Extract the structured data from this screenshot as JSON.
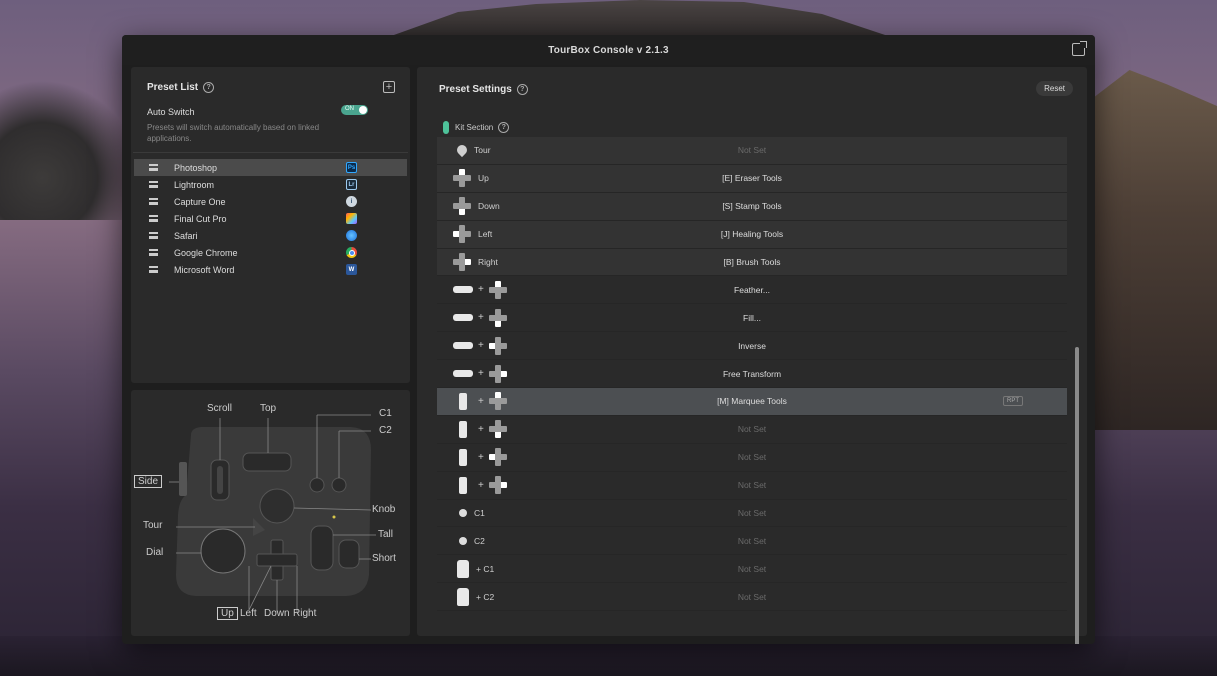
{
  "window": {
    "title": "TourBox Console v 2.1.3"
  },
  "preset_list": {
    "title": "Preset List",
    "help": "?",
    "add": "+",
    "auto_switch": {
      "label": "Auto Switch",
      "toggle": "ON",
      "description": "Presets will switch automatically based on linked applications."
    },
    "items": [
      {
        "label": "Photoshop",
        "icon": "photoshop-icon",
        "icon_text": "Ps",
        "selected": true
      },
      {
        "label": "Lightroom",
        "icon": "lightroom-icon",
        "icon_text": "Lr"
      },
      {
        "label": "Capture One",
        "icon": "capture-one-icon",
        "icon_text": "i"
      },
      {
        "label": "Final Cut Pro",
        "icon": "final-cut-pro-icon",
        "icon_text": ""
      },
      {
        "label": "Safari",
        "icon": "safari-icon",
        "icon_text": ""
      },
      {
        "label": "Google Chrome",
        "icon": "chrome-icon",
        "icon_text": ""
      },
      {
        "label": "Microsoft Word",
        "icon": "word-icon",
        "icon_text": "W"
      }
    ]
  },
  "diagram": {
    "labels": {
      "scroll": "Scroll",
      "top": "Top",
      "c1": "C1",
      "c2": "C2",
      "side": "Side",
      "knob": "Knob",
      "tour": "Tour",
      "tall": "Tall",
      "dial": "Dial",
      "short": "Short",
      "up": "Up",
      "left": "Left",
      "down": "Down",
      "right": "Right"
    }
  },
  "settings": {
    "title": "Preset Settings",
    "help": "?",
    "reset_label": "Reset",
    "kit_section": "Kit Section",
    "rows": [
      {
        "label": "Tour",
        "value": "Not Set",
        "icon": "tour-icon",
        "kit": true,
        "not_set": true
      },
      {
        "label": "Up",
        "value": "[E] Eraser Tools",
        "icon": "dpad-up-icon",
        "kit": true
      },
      {
        "label": "Down",
        "value": "[S] Stamp Tools",
        "icon": "dpad-down-icon",
        "kit": true
      },
      {
        "label": "Left",
        "value": "[J] Healing Tools",
        "icon": "dpad-left-icon",
        "kit": true
      },
      {
        "label": "Right",
        "value": "[B] Brush Tools",
        "icon": "dpad-right-icon",
        "kit": true
      },
      {
        "label": "",
        "value": "Feather...",
        "icon": "top-plus-up-icon"
      },
      {
        "label": "",
        "value": "Fill...",
        "icon": "top-plus-down-icon"
      },
      {
        "label": "",
        "value": "Inverse",
        "icon": "top-plus-left-icon"
      },
      {
        "label": "",
        "value": "Free Transform",
        "icon": "top-plus-right-icon"
      },
      {
        "label": "",
        "value": "[M] Marquee Tools",
        "icon": "side-plus-up-icon",
        "highlighted": true,
        "badge": "RPT"
      },
      {
        "label": "",
        "value": "Not Set",
        "icon": "side-plus-down-icon",
        "not_set": true
      },
      {
        "label": "",
        "value": "Not Set",
        "icon": "side-plus-left-icon",
        "not_set": true
      },
      {
        "label": "",
        "value": "Not Set",
        "icon": "side-plus-right-icon",
        "not_set": true
      },
      {
        "label": "C1",
        "value": "Not Set",
        "icon": "c1-dot-icon",
        "not_set": true
      },
      {
        "label": "C2",
        "value": "Not Set",
        "icon": "c2-dot-icon",
        "not_set": true
      },
      {
        "label": "+ C1",
        "value": "Not Set",
        "icon": "tall-plus-c1-icon",
        "not_set": true
      },
      {
        "label": "+ C2",
        "value": "Not Set",
        "icon": "tall-plus-c2-icon",
        "not_set": true
      }
    ]
  },
  "colors": {
    "accent": "#4ec29a",
    "toggle_on": "#4aa58f"
  }
}
